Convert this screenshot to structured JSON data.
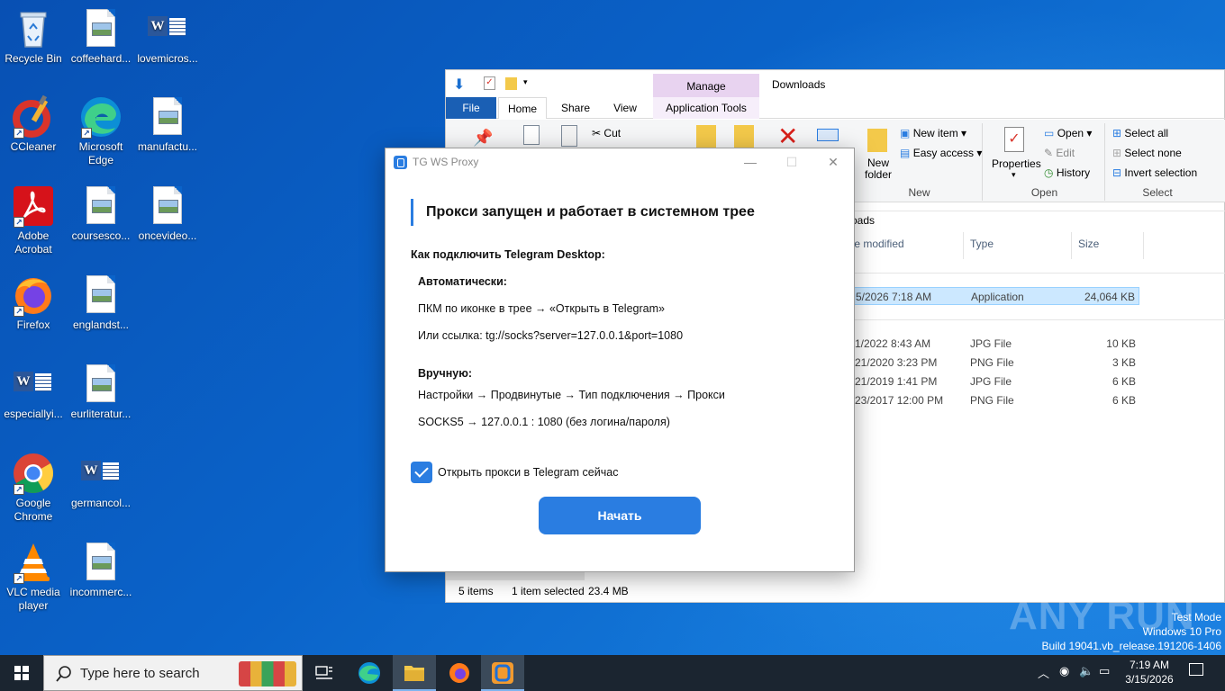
{
  "desktop": {
    "icons": [
      {
        "label": "Recycle Bin"
      },
      {
        "label": "coffeehard..."
      },
      {
        "label": "lovemicros..."
      },
      {
        "label": "CCleaner"
      },
      {
        "label": "Microsoft Edge"
      },
      {
        "label": "manufactu..."
      },
      {
        "label": "Adobe Acrobat"
      },
      {
        "label": "coursesco..."
      },
      {
        "label": "oncevideo..."
      },
      {
        "label": "Firefox"
      },
      {
        "label": "englandst..."
      },
      {
        "label": "especiallyi..."
      },
      {
        "label": "eurliteratur..."
      },
      {
        "label": "Google Chrome"
      },
      {
        "label": "germancol..."
      },
      {
        "label": "VLC media player"
      },
      {
        "label": "incommerc..."
      }
    ]
  },
  "explorer": {
    "title": "Downloads",
    "manage_label": "Manage",
    "tabs": {
      "file": "File",
      "home": "Home",
      "share": "Share",
      "view": "View",
      "app_tools": "Application Tools"
    },
    "ribbon": {
      "cut": "Cut",
      "new_item": "New item",
      "easy_access": "Easy access",
      "new_folder": "New folder",
      "group_new": "New",
      "properties": "Properties",
      "open": "Open",
      "edit": "Edit",
      "history": "History",
      "group_open": "Open",
      "select_all": "Select all",
      "select_none": "Select none",
      "invert_selection": "Invert selection",
      "group_select": "Select"
    },
    "address_tail": "oads",
    "columns": {
      "date": "te modified",
      "type": "Type",
      "size": "Size"
    },
    "files": [
      {
        "date": "5/2026 7:18 AM",
        "type": "Application",
        "size": "24,064 KB"
      },
      {
        "date": "1/2022 8:43 AM",
        "type": "JPG File",
        "size": "10 KB"
      },
      {
        "date": "21/2020 3:23 PM",
        "type": "PNG File",
        "size": "3 KB"
      },
      {
        "date": "21/2019 1:41 PM",
        "type": "JPG File",
        "size": "6 KB"
      },
      {
        "date": "23/2017 12:00 PM",
        "type": "PNG File",
        "size": "6 KB"
      }
    ],
    "status": {
      "items": "5 items",
      "selected": "1 item selected",
      "size": "23.4 MB"
    }
  },
  "dialog": {
    "title": "TG WS Proxy",
    "heading": "Прокси запущен и работает в системном трее",
    "how_to": "Как подключить Telegram Desktop:",
    "auto_header": "Автоматически:",
    "auto_line1": "ПКМ по иконке в трее → «Открыть в Telegram»",
    "auto_line2": "Или ссылка: tg://socks?server=127.0.0.1&port=1080",
    "manual_header": "Вручную:",
    "manual_line1": "Настройки → Продвинутые → Тип подключения → Прокси",
    "manual_line2": "SOCKS5 → 127.0.0.1 : 1080 (без логина/пароля)",
    "checkbox_label": "Открыть прокси в Telegram сейчас",
    "checkbox_checked": true,
    "start_button": "Начать",
    "accent_color": "#2a7de1"
  },
  "watermark": {
    "brand": "ANY RUN",
    "test_mode": "Test Mode",
    "edition": "Windows 10 Pro",
    "build": "Build 19041.vb_release.191206-1406"
  },
  "taskbar": {
    "search_placeholder": "Type here to search",
    "time": "7:19 AM",
    "date": "3/15/2026"
  }
}
